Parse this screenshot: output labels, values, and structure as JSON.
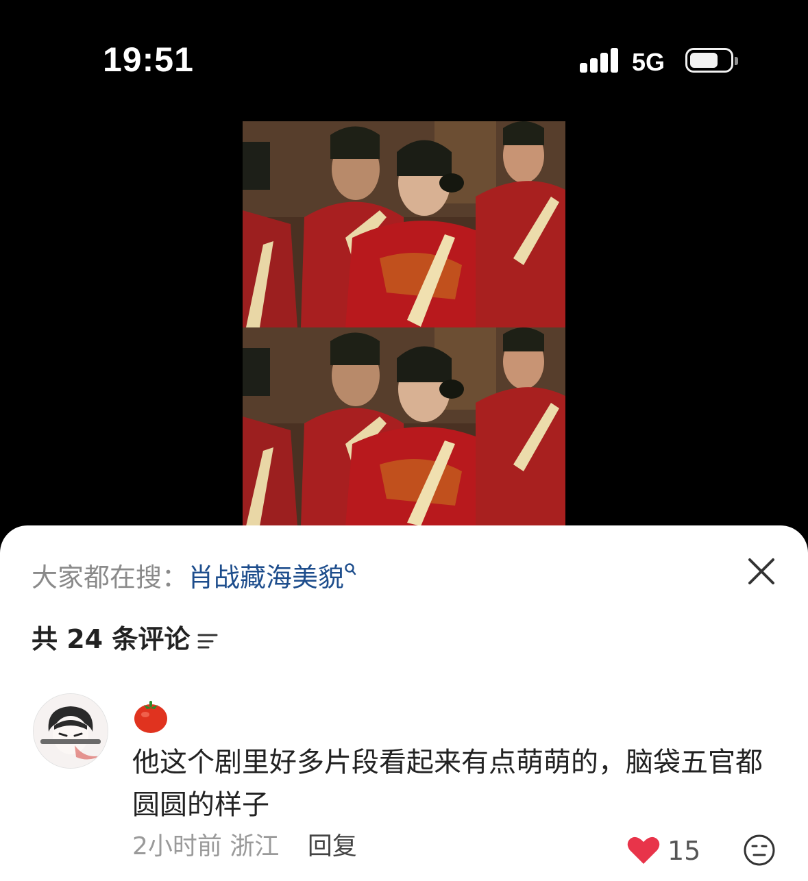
{
  "status_bar": {
    "time": "19:51",
    "network": "5G"
  },
  "search": {
    "prefix": "大家都在搜：",
    "term": "肖战藏海美貌"
  },
  "comments_header": {
    "count_label": "共 24 条评论"
  },
  "comment": {
    "text": "他这个剧里好多片段看起来有点萌萌的，脑袋五官都圆圆的样子",
    "time": "2小时前",
    "location": "浙江",
    "reply_label": "回复",
    "like_count": "15"
  },
  "colors": {
    "search_term": "#1d4d8c",
    "like_heart": "#e8344a",
    "background": "#000000"
  },
  "icons": [
    "signal-icon",
    "battery-icon",
    "search-icon",
    "close-icon",
    "sort-icon",
    "tomato-emoji-icon",
    "heart-icon",
    "emoji-reaction-icon"
  ]
}
